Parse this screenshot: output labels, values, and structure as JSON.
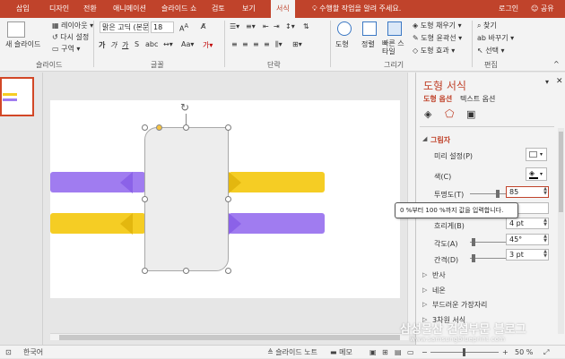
{
  "tabs": [
    "삽입",
    "디자인",
    "전환",
    "애니메이션",
    "슬라이드 쇼",
    "검토",
    "보기",
    "서식"
  ],
  "active_tab": "서식",
  "tell_me": "수행할 작업을 알려 주세요.",
  "login": "로그인",
  "share": "공유",
  "ribbon": {
    "new_slide": "새 슬라이드",
    "layout": "레이아웃",
    "reset": "다시 설정",
    "section": "구역",
    "font_name": "맑은 고딕 (본문",
    "font_size": "18",
    "shapes": "도형",
    "arrange": "정렬",
    "quick_styles": "빠른 스타일",
    "shape_fill": "도형 채우기",
    "shape_outline": "도형 윤곽선",
    "shape_effects": "도형 효과",
    "find": "찾기",
    "replace": "바꾸기",
    "select": "선택",
    "groups": {
      "slides": "슬라이드",
      "font": "글꼴",
      "paragraph": "단락",
      "drawing": "그리기",
      "editing": "편집"
    }
  },
  "pane": {
    "title": "도형 서식",
    "subtab_shape": "도형 옵션",
    "subtab_text": "텍스트 옵션",
    "section_shadow": "그림자",
    "preset_label": "미리 설정(P)",
    "color_label": "색(C)",
    "transparency_label": "투명도(T)",
    "transparency_value": "85",
    "transparency_value_pct": 85,
    "size_value": "%",
    "blur_label": "흐리게(B)",
    "blur_value": "4 pt",
    "angle_label": "각도(A)",
    "angle_value": "45°",
    "distance_label": "간격(D)",
    "distance_value": "3 pt",
    "sections": [
      "반사",
      "네온",
      "부드러운 가장자리",
      "3차원 서식"
    ],
    "tooltip": "0 %부터 100 %까지 값을 입력합니다."
  },
  "status": {
    "language": "한국어",
    "notes": "슬라이드 노트",
    "memo": "메모",
    "zoom": "50 %"
  },
  "colors": {
    "accent": "#c0432b",
    "purple": "#a07cf0",
    "yellow": "#f5cd24"
  },
  "watermark": {
    "line1": "삼성물산 건설부문 블로그",
    "line2": "www.samsungblueprint.com"
  }
}
